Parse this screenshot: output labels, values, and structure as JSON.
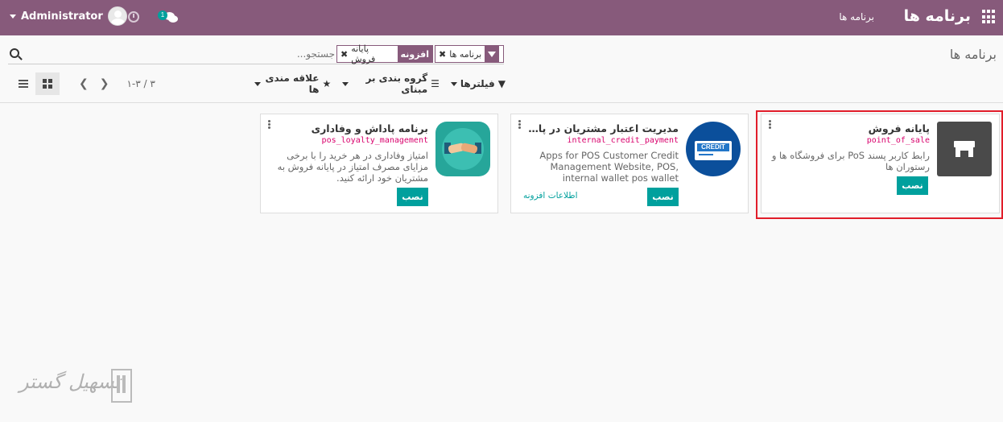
{
  "navbar": {
    "brand": "برنامه ها",
    "menu_item": "برنامه ها",
    "user_name": "Administrator",
    "chat_badge_count": "1",
    "apps_icon": "grid-apps-icon",
    "clock_icon": "clock-icon",
    "chat_icon": "chat-bubbles-icon"
  },
  "breadcrumb": "برنامه ها",
  "search": {
    "placeholder": "جستجو...",
    "facets": [
      {
        "icon": "filter-icon",
        "values": [
          "برنامه ها"
        ]
      },
      {
        "icon_label": "افزونه",
        "values": [
          "پایانه فروش"
        ]
      }
    ]
  },
  "searchview": {
    "filters_label": "فیلترها",
    "groupby_label": "گروه بندی بر مبنای",
    "favorites_label": "علاقه مندی ها"
  },
  "pager": {
    "value": "۱-۳ / ۳"
  },
  "views": {
    "kanban": "kanban-view-icon",
    "list": "list-view-icon",
    "active": "kanban"
  },
  "cards": [
    {
      "title": "پایانه فروش",
      "technical_name": "point_of_sale",
      "description": "رابط کاربر پسند PoS برای فروشگاه ها و رستوران ها",
      "install_label": "نصب",
      "icon": "store-icon"
    },
    {
      "title": "مدیریت اعتبار مشتریان در پایانه ...",
      "technical_name": "internal_credit_payment",
      "description": "Apps for POS Customer Credit Management Website, POS, internal wallet pos wallet",
      "install_label": "نصب",
      "learn_more_label": "اطلاعات افزونه",
      "icon": "credit-card-icon",
      "icon_text": "CREDIT"
    },
    {
      "title": "برنامه پاداش و وفاداری",
      "technical_name": "pos_loyalty_management",
      "description": "امتیاز وفاداری در هر خرید را با برخی مزایای مصرف امتیاز در پایانه فروش به مشتریان خود ارائه کنید.",
      "install_label": "نصب",
      "icon": "handshake-icon"
    }
  ],
  "watermark": {
    "text": "تسهیل گستر"
  },
  "colors": {
    "navbar": "#875a7b",
    "accent": "#00a09d",
    "highlight": "#e11d2a"
  }
}
